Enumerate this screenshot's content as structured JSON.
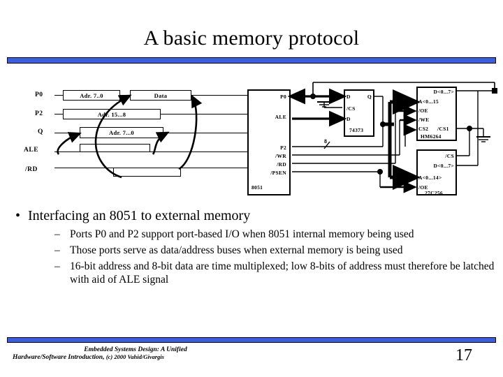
{
  "slide": {
    "title": "A basic memory protocol",
    "page_number": "17",
    "accent_color": "#3b5fe2"
  },
  "timing_diagram": {
    "signals": [
      "P0",
      "P2",
      "Q",
      "ALE",
      "/RD"
    ],
    "boxes": [
      {
        "signal": "P0",
        "label": "Adr. 7..0"
      },
      {
        "signal": "P0",
        "label": "Data"
      },
      {
        "signal": "P2",
        "label": "Adr. 15...8"
      },
      {
        "signal": "Q",
        "label": "Adr. 7...0"
      }
    ]
  },
  "circuit": {
    "mcu": {
      "name": "8051",
      "pins": [
        "P0",
        "ALE",
        "P2",
        "/WR",
        "/RD",
        "/PSEN"
      ]
    },
    "latch": {
      "name": "74373",
      "pins_left": [
        "D",
        "/CS",
        "D"
      ],
      "pins_right": [
        "Q"
      ]
    },
    "sram": {
      "name": "HM6264",
      "pins_right": [
        "D<0...7>"
      ],
      "pins_left": [
        "A<0...15",
        "/OE",
        "/WE"
      ],
      "pins_bottom": [
        "CS2",
        "/CS1"
      ]
    },
    "rom": {
      "name": "27C256",
      "pins_right": [
        "/CS",
        "D<0...7>"
      ],
      "pins_left": [
        "A<0...14>",
        "/OE"
      ]
    },
    "bus_width_label": "8"
  },
  "body": {
    "bullet": "Interfacing an 8051 to external memory",
    "bullet_marker": "•",
    "dash_marker": "–",
    "sub_bullets": [
      "Ports P0 and P2 support port-based I/O when 8051 internal memory being used",
      "Those ports serve as data/address buses when external memory is being used",
      "16-bit address and 8-bit data are time multiplexed; low 8-bits of address must therefore be latched with aid of ALE signal"
    ]
  },
  "footer": {
    "line1": "Embedded Systems Design: A Unified",
    "line2_italic": "Hardware/Software Introduction,",
    "line2_plain": "(c) 2000 Vahid/Givargis"
  }
}
